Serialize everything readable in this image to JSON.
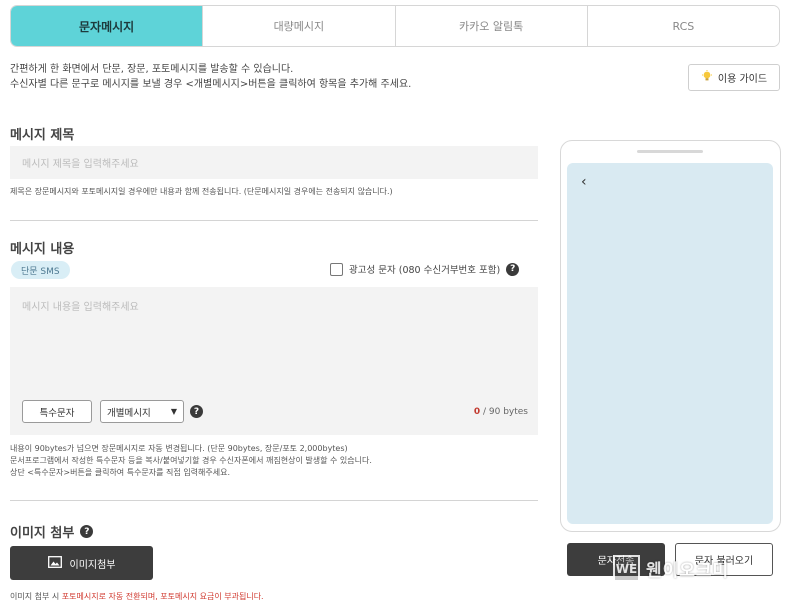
{
  "tabs": [
    {
      "label": "문자메시지",
      "active": true
    },
    {
      "label": "대량메시지",
      "active": false
    },
    {
      "label": "카카오 알림톡",
      "active": false
    },
    {
      "label": "RCS",
      "active": false
    }
  ],
  "intro": {
    "line1": "간편하게 한 화면에서 단문, 장문, 포토메시지를 발송할 수 있습니다.",
    "line2": "수신자별 다른 문구로 메시지를 보낼 경우 <개별메시지>버튼을 클릭하여 항목을 추가해 주세요."
  },
  "guide_button": {
    "label": "이용 가이드",
    "icon": "lightbulb-icon"
  },
  "subject": {
    "title": "메시지 제목",
    "placeholder": "메시지 제목을 입력해주세요",
    "note": "제목은 장문메시지와 포토메시지일 경우에만 내용과 함께 전송됩니다. (단문메시지일 경우에는 전송되지 않습니다.)"
  },
  "content": {
    "title": "메시지 내용",
    "badge": "단문 SMS",
    "ad_label": "광고성 문자 (080 수신거부번호 포함)",
    "placeholder": "메시지 내용을 입력해주세요",
    "special_button": "특수문자",
    "select_value": "개별메시지",
    "byte_count": "0",
    "byte_limit": " / 90 bytes",
    "notes": [
      "내용이 90bytes가 넘으면 장문메시지로 자동 변경됩니다. (단문 90bytes, 장문/포토 2,000bytes)",
      "문서프로그램에서 작성한 특수문자 등을 복사/붙여넣기할 경우 수신자폰에서 깨짐현상이 발생할 수 있습니다.",
      "상단 <특수문자>버튼을 클릭하여 특수문자를 직접 입력해주세요."
    ]
  },
  "image": {
    "title": "이미지 첨부",
    "button": "이미지첨부",
    "note_prefix": "이미지 첨부 시 ",
    "note_red": "포토메시지로 자동 전환되며, 포토메시지 요금이 부과됩니다."
  },
  "actions": {
    "send": "문자전송",
    "load": "문자 불러오기"
  },
  "watermark": {
    "logo": "WE",
    "text": "웬이오크미"
  },
  "colors": {
    "accent": "#5ed3d8",
    "phone_screen": "#d9eaf2",
    "dark_button": "#3d3d3d",
    "warning": "#d0392f"
  }
}
